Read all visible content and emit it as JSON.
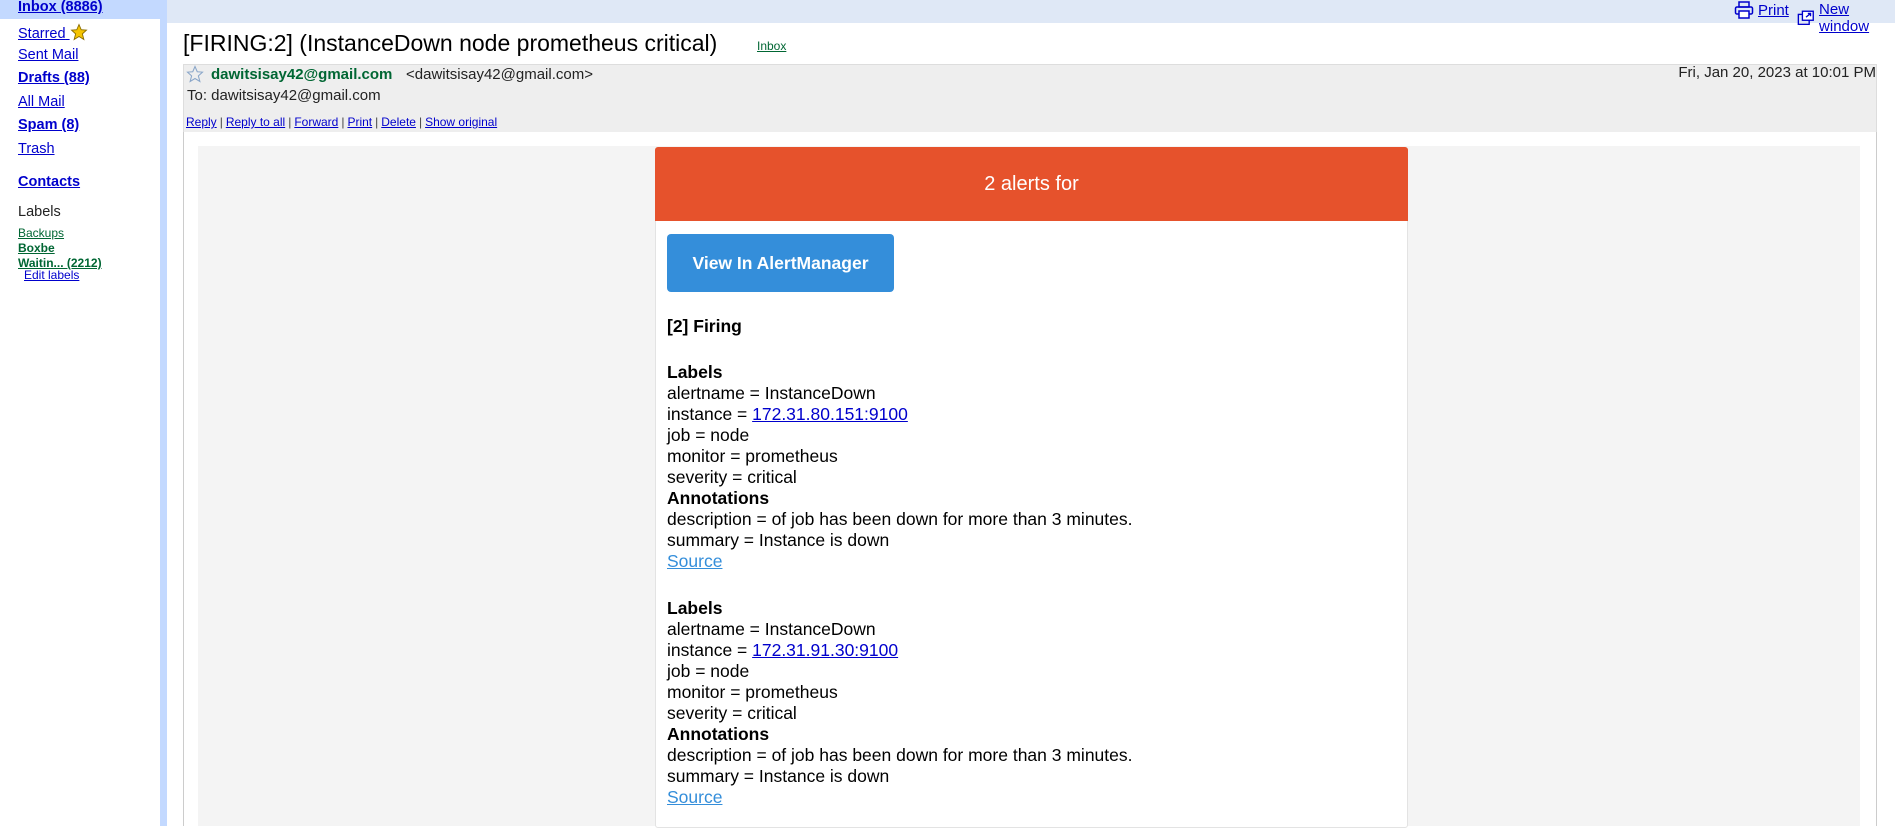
{
  "sidebar": {
    "inbox": "Inbox (8886)",
    "starred": "Starred",
    "sent": "Sent Mail",
    "drafts": "Drafts (88)",
    "all_mail": "All Mail",
    "spam": "Spam (8)",
    "trash": "Trash",
    "contacts": "Contacts",
    "labels_title": "Labels",
    "labels": [
      "Backups",
      "Boxbe",
      "Waitin... (2212)"
    ],
    "edit_labels": "Edit labels"
  },
  "topbar": {
    "print": "Print",
    "new_window": "New window"
  },
  "message": {
    "subject": "[FIRING:2] (InstanceDown node prometheus critical)",
    "inbox_tag": "Inbox",
    "from_name": "dawitsisay42@gmail.com",
    "from_email": "<dawitsisay42@gmail.com>",
    "date": "Fri, Jan 20, 2023 at 10:01 PM",
    "to": "To: dawitsisay42@gmail.com",
    "actions": [
      "Reply",
      "Reply to all",
      "Forward",
      "Print",
      "Delete",
      "Show original"
    ]
  },
  "email": {
    "header": "2 alerts for",
    "button": "View In AlertManager",
    "firing": "[2] Firing",
    "alerts": [
      {
        "labels_title": "Labels",
        "alertname": "alertname = InstanceDown",
        "instance_prefix": "instance = ",
        "instance": "172.31.80.151:9100",
        "job": "job = node",
        "monitor": "monitor = prometheus",
        "severity": "severity = critical",
        "annotations_title": "Annotations",
        "description": "description = of job has been down for more than 3 minutes.",
        "summary": "summary = Instance is down",
        "source": "Source"
      },
      {
        "labels_title": "Labels",
        "alertname": "alertname = InstanceDown",
        "instance_prefix": "instance = ",
        "instance": "172.31.91.30:9100",
        "job": "job = node",
        "monitor": "monitor = prometheus",
        "severity": "severity = critical",
        "annotations_title": "Annotations",
        "description": "description = of job has been down for more than 3 minutes.",
        "summary": "summary = Instance is down",
        "source": "Source"
      }
    ]
  },
  "colors": {
    "alert_header": "#e6522c",
    "button": "#348eda",
    "link": "#0000cc",
    "label_green": "#006633"
  }
}
